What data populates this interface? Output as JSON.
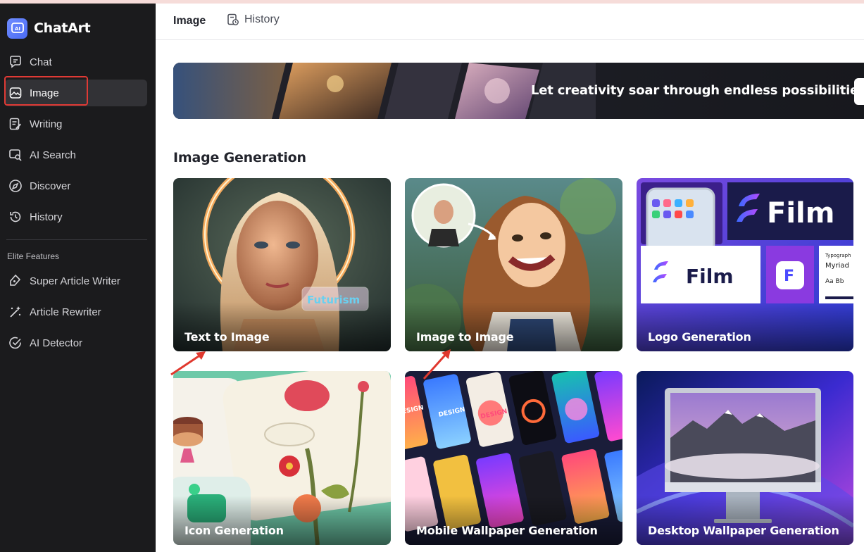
{
  "app": {
    "name": "ChatArt",
    "accent": "#4b6bf5"
  },
  "sidebar": {
    "items": [
      {
        "label": "Chat",
        "icon": "chat-icon"
      },
      {
        "label": "Image",
        "icon": "image-icon",
        "active": true
      },
      {
        "label": "Writing",
        "icon": "writing-icon"
      },
      {
        "label": "AI Search",
        "icon": "ai-search-icon"
      },
      {
        "label": "Discover",
        "icon": "compass-icon"
      },
      {
        "label": "History",
        "icon": "history-icon"
      }
    ],
    "elite_title": "Elite Features",
    "elite_items": [
      {
        "label": "Super Article Writer",
        "icon": "pen-icon"
      },
      {
        "label": "Article Rewriter",
        "icon": "magic-wand-icon"
      },
      {
        "label": "AI Detector",
        "icon": "check-circle-icon"
      }
    ]
  },
  "header": {
    "tabs": [
      {
        "label": "Image",
        "active": true
      },
      {
        "label": "History",
        "icon": "history-doc-icon"
      }
    ]
  },
  "banner": {
    "text": "Let creativity soar through endless possibilities"
  },
  "section": {
    "title": "Image Generation"
  },
  "cards": [
    {
      "label": "Text to Image",
      "badge": "Futurism"
    },
    {
      "label": "Image to Image"
    },
    {
      "label": "Logo Generation",
      "brand_text": "Film",
      "font_sample_title": "Typograph",
      "font_sample_name": "Myriad",
      "font_sample_chars": "Aa Bb"
    },
    {
      "label": "Icon Generation"
    },
    {
      "label": "Mobile Wallpaper Generation",
      "tile_text": "DESIGN"
    },
    {
      "label": "Desktop Wallpaper Generation"
    }
  ]
}
